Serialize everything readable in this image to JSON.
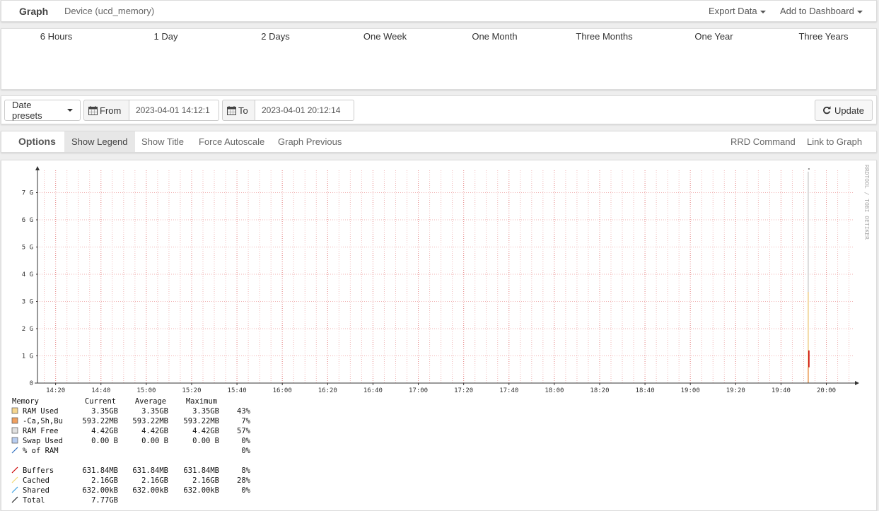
{
  "header": {
    "title": "Graph",
    "subtitle": "Device (ucd_memory)",
    "export_label": "Export Data",
    "dashboard_label": "Add to Dashboard"
  },
  "ranges": [
    "6 Hours",
    "1 Day",
    "2 Days",
    "One Week",
    "One Month",
    "Three Months",
    "One Year",
    "Three Years"
  ],
  "dateform": {
    "presets_label": "Date presets",
    "from_label": "From",
    "from_value": "2023-04-01 14:12:1",
    "to_label": "To",
    "to_value": "2023-04-01 20:12:14",
    "update_label": "Update"
  },
  "options": {
    "head": "Options",
    "show_legend": "Show Legend",
    "show_title": "Show Title",
    "force_autoscale": "Force Autoscale",
    "graph_previous": "Graph Previous",
    "rrd_command": "RRD Command",
    "link_to_graph": "Link to Graph"
  },
  "chart_data": {
    "type": "area",
    "watermark": "RRDTOOL / TOBI OETIKER",
    "y_ticks": [
      "0",
      "1 G",
      "2 G",
      "3 G",
      "4 G",
      "5 G",
      "6 G",
      "7 G"
    ],
    "ylim": [
      0,
      7.77
    ],
    "x_ticks": [
      "14:20",
      "14:40",
      "15:00",
      "15:20",
      "15:40",
      "16:00",
      "16:20",
      "16:40",
      "17:00",
      "17:20",
      "17:40",
      "18:00",
      "18:20",
      "18:40",
      "19:00",
      "19:20",
      "19:40",
      "20:00"
    ],
    "xlim_minutes": [
      852,
      1212
    ],
    "sample_time_minutes": 1192,
    "spike": {
      "ram_used_gb": 3.35,
      "ca_sh_bu_gb": 0.58,
      "ram_free_gb": 4.42,
      "buffers_gb": 0.62,
      "cached_gb": 2.16
    },
    "legend": {
      "headers": [
        "Memory",
        "Current",
        "Average",
        "Maximum"
      ],
      "rows": [
        {
          "label": "RAM Used",
          "color": "#f5d58e",
          "swatch": "box",
          "current": "3.35GB",
          "average": "3.35GB",
          "maximum": "3.35GB",
          "percent": "43%"
        },
        {
          "label": "-Ca,Sh,Bu",
          "color": "#f0a060",
          "swatch": "box",
          "current": "593.22MB",
          "average": "593.22MB",
          "maximum": "593.22MB",
          "percent": "7%"
        },
        {
          "label": "RAM Free",
          "color": "#e0e0e0",
          "swatch": "box",
          "current": "4.42GB",
          "average": "4.42GB",
          "maximum": "4.42GB",
          "percent": "57%"
        },
        {
          "label": "Swap Used",
          "color": "#b8cdf0",
          "swatch": "box",
          "current": "0.00 B",
          "average": "0.00 B",
          "maximum": "0.00 B",
          "percent": "0%"
        },
        {
          "label": "% of RAM",
          "color": "#3070c0",
          "swatch": "line",
          "current": "",
          "average": "",
          "maximum": "",
          "percent": "0%"
        },
        {
          "label": "Buffers",
          "color": "#cc0000",
          "swatch": "line",
          "current": "631.84MB",
          "average": "631.84MB",
          "maximum": "631.84MB",
          "percent": "8%"
        },
        {
          "label": "Cached",
          "color": "#f0d870",
          "swatch": "line",
          "current": "2.16GB",
          "average": "2.16GB",
          "maximum": "2.16GB",
          "percent": "28%"
        },
        {
          "label": "Shared",
          "color": "#3aa0e0",
          "swatch": "line",
          "current": "632.00kB",
          "average": "632.00kB",
          "maximum": "632.00kB",
          "percent": "0%"
        },
        {
          "label": "Total",
          "color": "#222222",
          "swatch": "line",
          "current": "7.77GB",
          "average": "",
          "maximum": "",
          "percent": ""
        }
      ]
    }
  }
}
